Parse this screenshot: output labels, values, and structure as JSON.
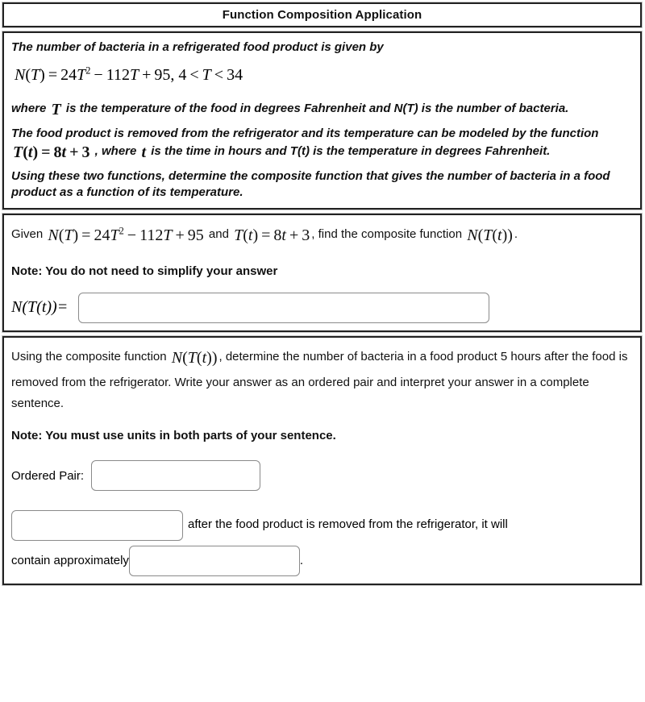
{
  "header": {
    "title": "Function Composition Application"
  },
  "problem": {
    "intro": "The number of bacteria in a refrigerated food product is given by",
    "formula_N": "N(T) = 24T² − 112T + 95 , 4 < T < 34",
    "where_line": "where T is the temperature of the food in degrees Fahrenheit and N(T) is the number of bacteria.",
    "where_pre": "where",
    "where_var": "T",
    "where_post": "is the temperature of the food in degrees Fahrenheit and N(T) is the number of bacteria.",
    "model_pre": "The food product is removed from the refrigerator and its temperature can be modeled by the function",
    "model_formula": "T(t) = 8t + 3",
    "model_mid": ", where",
    "model_var": "t",
    "model_post": "is the time in hours and T(t) is the temperature in degrees Fahrenheit.",
    "task": "Using these two functions, determine the composite function that gives the number of bacteria in a food product as a function of its temperature."
  },
  "part_a": {
    "given_word": "Given",
    "formula_N": "N(T) = 24T² − 112T + 95",
    "and_word": "and",
    "formula_T": "T(t) = 8t + 3",
    "find_text": ", find the composite function",
    "composite": "N(T(t))",
    "period": ".",
    "note": "Note: You do not need to simplify your answer",
    "answer_label": "N(T(t)) =",
    "answer_value": "",
    "answer_placeholder": ""
  },
  "part_b": {
    "prompt_pre": "Using the composite function",
    "composite": "N(T(t))",
    "prompt_post": ", determine the number of bacteria in a food product 5 hours after the food is removed from the refrigerator. Write your answer as an ordered pair and interpret your answer in a complete sentence.",
    "hours": "5",
    "note": "Note: You must use units in both parts of your sentence.",
    "ordered_pair_label": "Ordered Pair:",
    "ordered_pair_value": "",
    "ordered_pair_placeholder": "",
    "sentence_time_value": "",
    "sentence_time_placeholder": "",
    "sentence_middle": "after the food product is removed from the refrigerator, it will",
    "sentence_continue": "contain approximately",
    "sentence_amount_value": "",
    "sentence_amount_placeholder": "",
    "sentence_end": "."
  },
  "colors": {
    "panel_border": "#222222",
    "panel_halo": "#c9c9c9",
    "field_border": "#8a8a8a",
    "text": "#111111",
    "background": "#ffffff"
  }
}
